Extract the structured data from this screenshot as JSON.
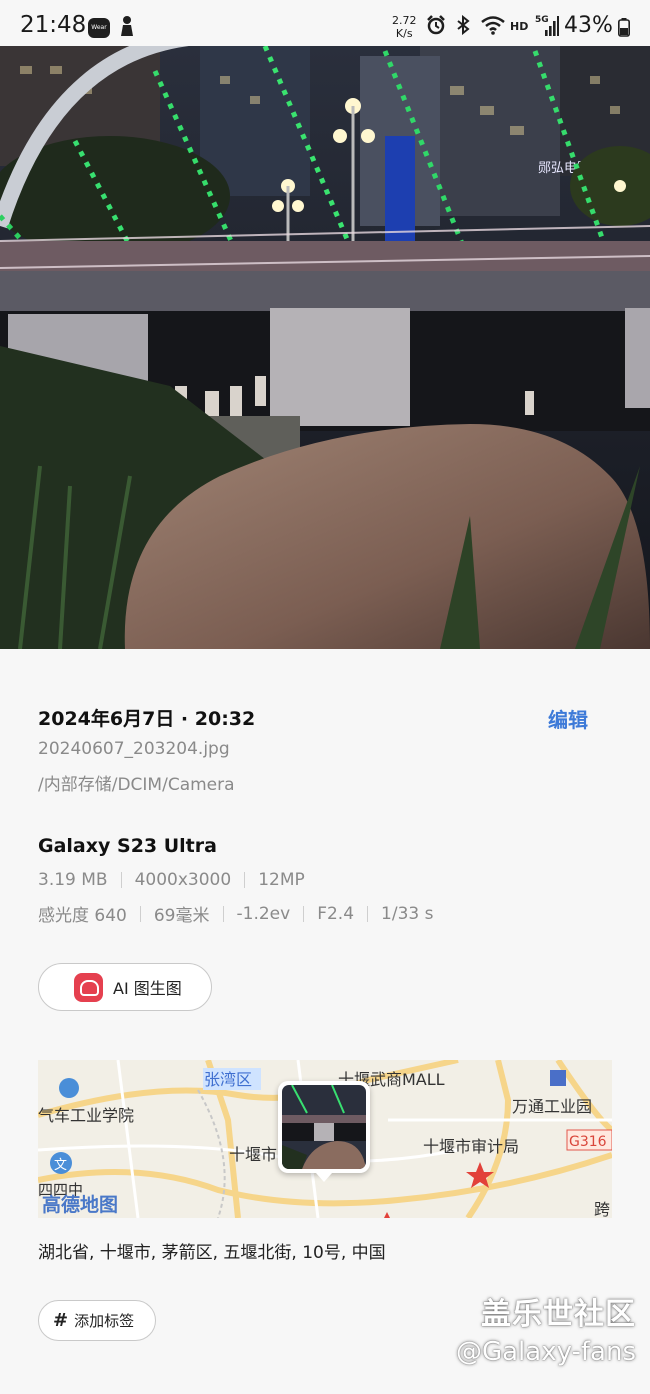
{
  "status_bar": {
    "time": "21:48",
    "wear_icon": "Wear",
    "speed_value": "2.72",
    "speed_unit": "K/s",
    "network_badge": "HD",
    "signal_badge": "5G",
    "battery": "43%"
  },
  "photo": {
    "subject": "night riverside bridge with LED lights"
  },
  "details": {
    "datetime": "2024年6月7日 · 20:32",
    "edit_label": "编辑",
    "filename": "20240607_203204.jpg",
    "path": "/内部存储/DCIM/Camera",
    "device": "Galaxy S23 Ultra",
    "specs_row1": [
      "3.19 MB",
      "4000x3000",
      "12MP"
    ],
    "specs_row2": [
      "感光度 640",
      "69毫米",
      "-1.2ev",
      "F2.4",
      "1/33 s"
    ],
    "ai_button_label": "AI 图生图",
    "address": "湖北省, 十堰市, 茅箭区, 五堰北街, 10号, 中国",
    "add_tag_label": "添加标签",
    "tag_hash": "#"
  },
  "map": {
    "labels": {
      "zhangwanqu": "张湾区",
      "mall": "十堰武商MALL",
      "college": "气车工业学院",
      "wantong": "万通工业园",
      "shiyan": "十堰市",
      "audit": "十堰市审计局",
      "g316": "G316",
      "logo": "高德地图",
      "kua": "跨",
      "wen": "文",
      "school": "四四中"
    }
  },
  "watermark": {
    "line1": "盖乐世社区",
    "line2": "@Galaxy-fans"
  },
  "colors": {
    "accent": "#3d7ad8",
    "secondary_text": "#8a8a8a",
    "background": "#f7f7f7"
  }
}
